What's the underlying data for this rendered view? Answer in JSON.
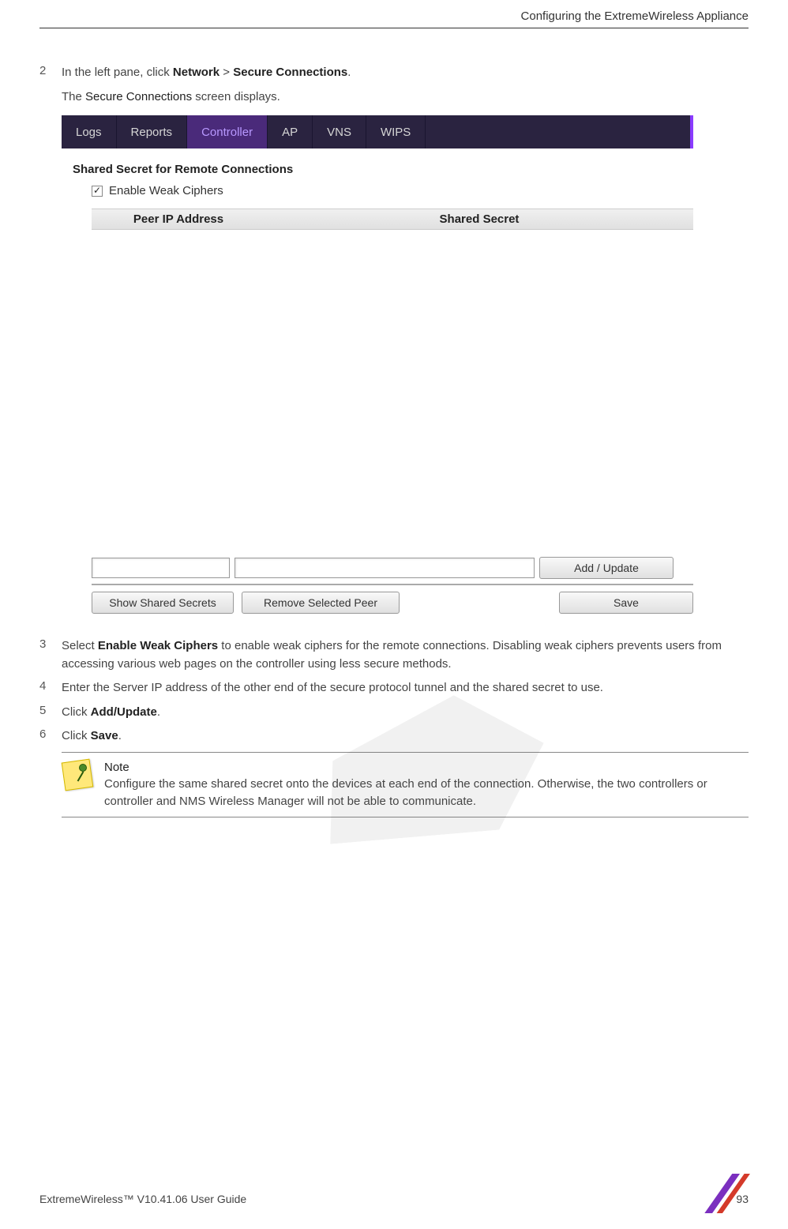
{
  "header": {
    "title": "Configuring the ExtremeWireless Appliance"
  },
  "steps": {
    "s2": {
      "num": "2",
      "pre": "In the left pane, click ",
      "b1": "Network",
      "mid": "  > ",
      "b2": "Secure Connections",
      "post": ".",
      "sub_pre": "The ",
      "sub_b": "Secure Connections",
      "sub_post": " screen displays."
    },
    "s3": {
      "num": "3",
      "pre": "Select ",
      "b1": "Enable Weak Ciphers",
      "post": " to enable weak ciphers for the remote connections. Disabling weak ciphers prevents users from accessing various web pages on the controller using less secure methods."
    },
    "s4": {
      "num": "4",
      "text": "Enter the Server IP address of the other end of the secure protocol tunnel and the shared secret to use."
    },
    "s5": {
      "num": "5",
      "pre": "Click ",
      "b1": "Add/Update",
      "post": "."
    },
    "s6": {
      "num": "6",
      "pre": "Click ",
      "b1": "Save",
      "post": "."
    }
  },
  "ui": {
    "tabs": [
      "Logs",
      "Reports",
      "Controller",
      "AP",
      "VNS",
      "WIPS"
    ],
    "active_tab_index": 2,
    "panel_title": "Shared Secret for Remote Connections",
    "checkbox_label": "Enable Weak Ciphers",
    "checkbox_checked": true,
    "table": {
      "col1": "Peer IP Address",
      "col2": "Shared Secret"
    },
    "buttons": {
      "add": "Add / Update",
      "show": "Show Shared Secrets",
      "remove": "Remove Selected Peer",
      "save": "Save"
    }
  },
  "note": {
    "title": "Note",
    "body": "Configure the same shared secret onto the devices at each end of the connection. Otherwise, the two controllers or controller and NMS Wireless Manager will not be able to communicate."
  },
  "footer": {
    "left": "ExtremeWireless™ V10.41.06 User Guide",
    "right": "93"
  }
}
